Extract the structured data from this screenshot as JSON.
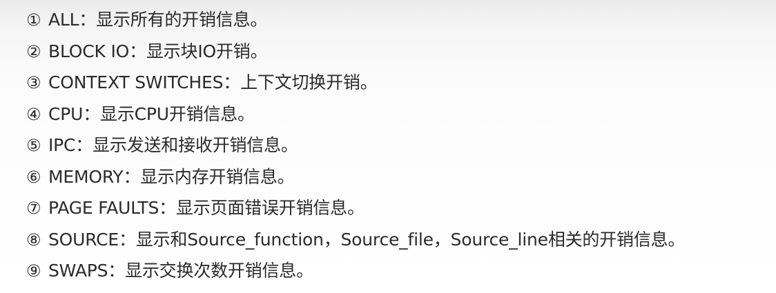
{
  "items": [
    {
      "num": "①",
      "text": "ALL：显示所有的开销信息。"
    },
    {
      "num": "②",
      "text": "BLOCK IO：显示块IO开销。"
    },
    {
      "num": "③",
      "text": "CONTEXT SWITCHES：上下文切换开销。"
    },
    {
      "num": "④",
      "text": "CPU：显示CPU开销信息。"
    },
    {
      "num": "⑤",
      "text": "IPC：显示发送和接收开销信息。"
    },
    {
      "num": "⑥",
      "text": "MEMORY：显示内存开销信息。"
    },
    {
      "num": "⑦",
      "text": "PAGE FAULTS：显示页面错误开销信息。"
    },
    {
      "num": "⑧",
      "text": "SOURCE：显示和Source_function，Source_file，Source_line相关的开销信息。"
    },
    {
      "num": "⑨",
      "text": "SWAPS：显示交换次数开销信息。"
    }
  ]
}
